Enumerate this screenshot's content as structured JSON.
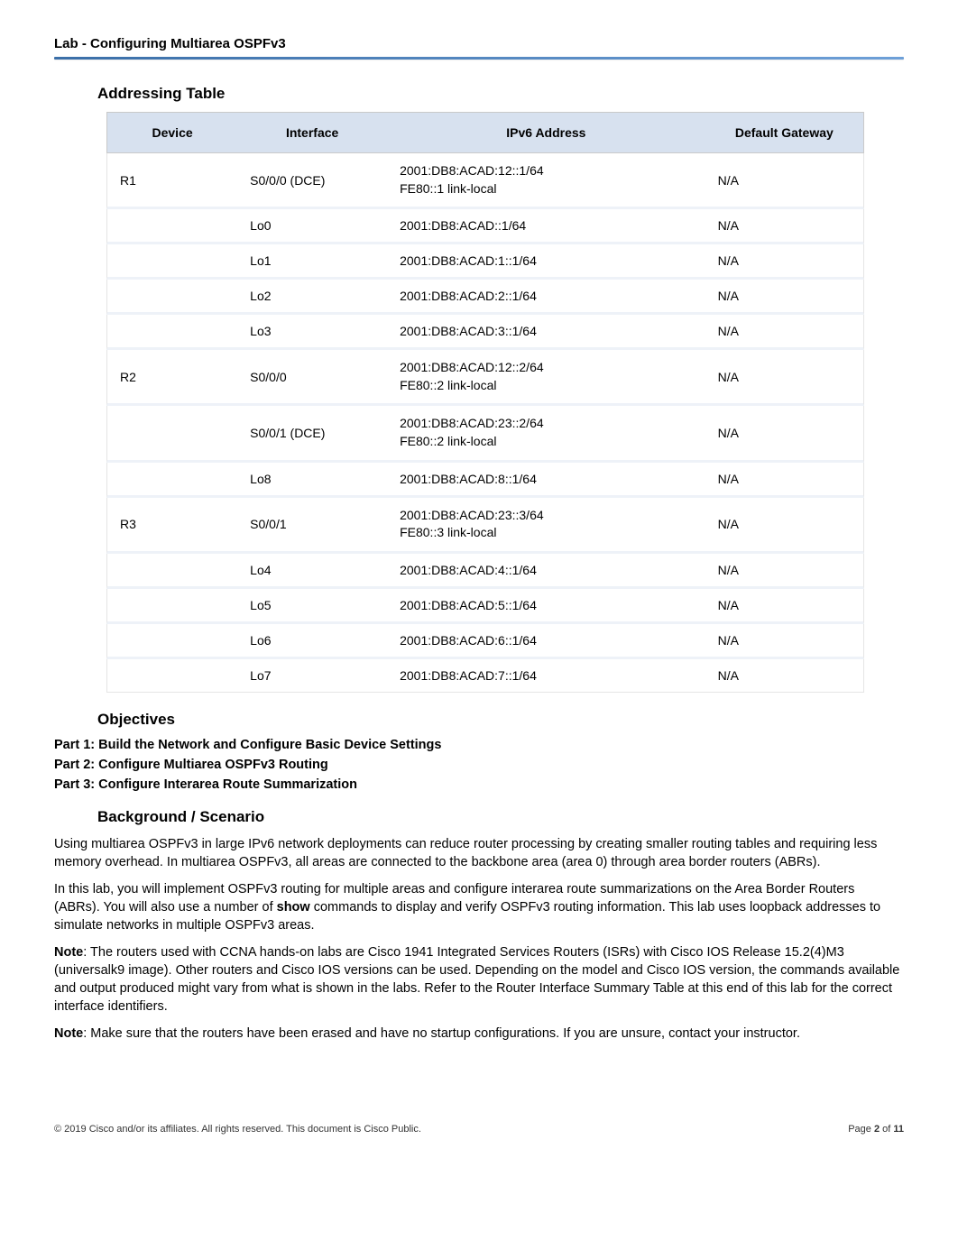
{
  "header": {
    "title": "Lab - Configuring Multiarea OSPFv3"
  },
  "sections": {
    "addressing_title": "Addressing Table",
    "objectives_title": "Objectives",
    "background_title": "Background / Scenario"
  },
  "table": {
    "headers": {
      "device": "Device",
      "interface": "Interface",
      "ipv6": "IPv6 Address",
      "gateway": "Default Gateway"
    },
    "rows": [
      {
        "device": "R1",
        "interface": "S0/0/0 (DCE)",
        "ipv6_a": "2001:DB8:ACAD:12::1/64",
        "ipv6_b": "FE80::1 link-local",
        "gateway": "N/A"
      },
      {
        "device": "",
        "interface": "Lo0",
        "ipv6_a": "2001:DB8:ACAD::1/64",
        "ipv6_b": "",
        "gateway": "N/A"
      },
      {
        "device": "",
        "interface": "Lo1",
        "ipv6_a": "2001:DB8:ACAD:1::1/64",
        "ipv6_b": "",
        "gateway": "N/A"
      },
      {
        "device": "",
        "interface": "Lo2",
        "ipv6_a": "2001:DB8:ACAD:2::1/64",
        "ipv6_b": "",
        "gateway": "N/A"
      },
      {
        "device": "",
        "interface": "Lo3",
        "ipv6_a": "2001:DB8:ACAD:3::1/64",
        "ipv6_b": "",
        "gateway": "N/A"
      },
      {
        "device": "R2",
        "interface": "S0/0/0",
        "ipv6_a": "2001:DB8:ACAD:12::2/64",
        "ipv6_b": "FE80::2 link-local",
        "gateway": "N/A"
      },
      {
        "device": "",
        "interface": "S0/0/1 (DCE)",
        "ipv6_a": "2001:DB8:ACAD:23::2/64",
        "ipv6_b": "FE80::2 link-local",
        "gateway": "N/A"
      },
      {
        "device": "",
        "interface": "Lo8",
        "ipv6_a": "2001:DB8:ACAD:8::1/64",
        "ipv6_b": "",
        "gateway": "N/A"
      },
      {
        "device": "R3",
        "interface": "S0/0/1",
        "ipv6_a": "2001:DB8:ACAD:23::3/64",
        "ipv6_b": "FE80::3 link-local",
        "gateway": "N/A"
      },
      {
        "device": "",
        "interface": "Lo4",
        "ipv6_a": "2001:DB8:ACAD:4::1/64",
        "ipv6_b": "",
        "gateway": "N/A"
      },
      {
        "device": "",
        "interface": "Lo5",
        "ipv6_a": "2001:DB8:ACAD:5::1/64",
        "ipv6_b": "",
        "gateway": "N/A"
      },
      {
        "device": "",
        "interface": "Lo6",
        "ipv6_a": "2001:DB8:ACAD:6::1/64",
        "ipv6_b": "",
        "gateway": "N/A"
      },
      {
        "device": "",
        "interface": "Lo7",
        "ipv6_a": "2001:DB8:ACAD:7::1/64",
        "ipv6_b": "",
        "gateway": "N/A"
      }
    ]
  },
  "objectives": {
    "p1": "Part 1: Build the Network and Configure Basic Device Settings",
    "p2": "Part 2: Configure Multiarea OSPFv3 Routing",
    "p3": "Part 3: Configure Interarea Route Summarization"
  },
  "background": {
    "para1": "Using multiarea OSPFv3 in large IPv6 network deployments can reduce router processing by creating smaller routing tables and requiring less memory overhead. In multiarea OSPFv3, all areas are connected to the backbone area (area 0) through area border routers (ABRs).",
    "para2_a": "In this lab, you will implement OSPFv3 routing for multiple areas and configure interarea route summarizations on the Area Border Routers (ABRs). You will also use a number of ",
    "para2_show": "show",
    "para2_b": " commands to display and verify OSPFv3 routing information. This lab uses loopback addresses to simulate networks in multiple OSPFv3 areas.",
    "para3_label": "Note",
    "para3": ": The routers used with CCNA hands-on labs are Cisco 1941 Integrated Services Routers (ISRs) with Cisco IOS Release 15.2(4)M3 (universalk9 image). Other routers and Cisco IOS versions can be used. Depending on the model and Cisco IOS version, the commands available and output produced might vary from what is shown in the labs. Refer to the Router Interface Summary Table at this end of this lab for the correct interface identifiers.",
    "para4_label": "Note",
    "para4": ": Make sure that the routers have been erased and have no startup configurations. If you are unsure, contact your instructor."
  },
  "footer": {
    "copyright": "© 2019 Cisco and/or its affiliates. All rights reserved. This document is Cisco Public.",
    "page_a": "Page ",
    "page_n": "2",
    "page_b": " of ",
    "page_t": "11"
  }
}
